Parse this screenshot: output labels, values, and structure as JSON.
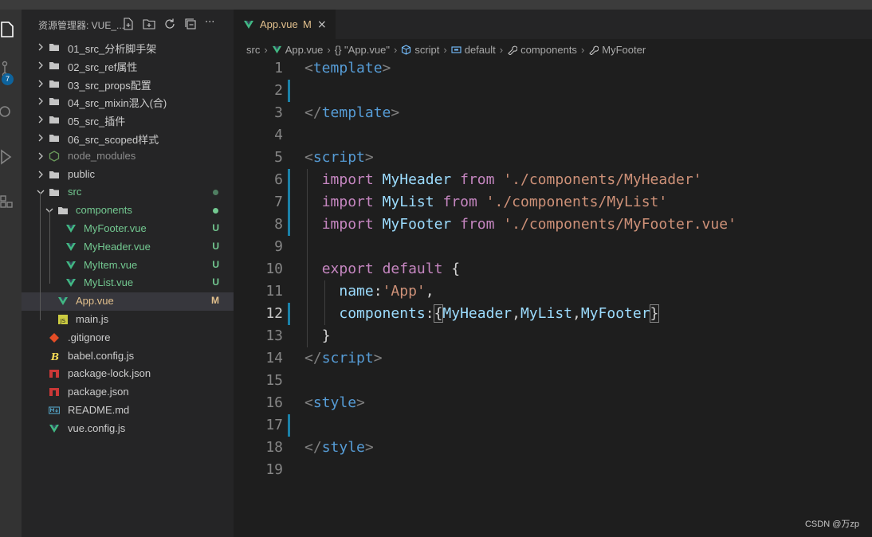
{
  "explorer": {
    "title": "资源管理器: VUE_...",
    "actions": [
      "new-file-icon",
      "new-folder-icon",
      "refresh-icon",
      "collapse-all-icon",
      "more-actions-icon"
    ],
    "more_label": "···",
    "items": [
      {
        "label": "01_src_分析脚手架",
        "type": "folder"
      },
      {
        "label": "02_src_ref属性",
        "type": "folder"
      },
      {
        "label": "03_src_props配置",
        "type": "folder"
      },
      {
        "label": "04_src_mixin混入(合)",
        "type": "folder"
      },
      {
        "label": "05_src_插件",
        "type": "folder"
      },
      {
        "label": "06_src_scoped样式",
        "type": "folder"
      },
      {
        "label": "node_modules",
        "type": "folder"
      },
      {
        "label": "public",
        "type": "folder"
      },
      {
        "label": "src",
        "type": "folder"
      },
      {
        "label": "components",
        "type": "folder"
      },
      {
        "label": "MyFooter.vue",
        "type": "vue",
        "status": "U"
      },
      {
        "label": "MyHeader.vue",
        "type": "vue",
        "status": "U"
      },
      {
        "label": "MyItem.vue",
        "type": "vue",
        "status": "U"
      },
      {
        "label": "MyList.vue",
        "type": "vue",
        "status": "U"
      },
      {
        "label": "App.vue",
        "type": "vue",
        "status": "M"
      },
      {
        "label": "main.js",
        "type": "js"
      },
      {
        "label": ".gitignore",
        "type": "git"
      },
      {
        "label": "babel.config.js",
        "type": "babel"
      },
      {
        "label": "package-lock.json",
        "type": "npm"
      },
      {
        "label": "package.json",
        "type": "npm"
      },
      {
        "label": "README.md",
        "type": "md"
      },
      {
        "label": "vue.config.js",
        "type": "vue"
      }
    ]
  },
  "activity_bar": {
    "source_control_badge": "7"
  },
  "editor": {
    "tab": {
      "label": "App.vue",
      "status": "M",
      "close": "×"
    },
    "breadcrumbs": [
      "src",
      "App.vue",
      "{} \"App.vue\"",
      "script",
      "default",
      "components",
      "MyFooter"
    ],
    "active_line": 12,
    "lines": [
      {
        "n": "1"
      },
      {
        "n": "2"
      },
      {
        "n": "3"
      },
      {
        "n": "4"
      },
      {
        "n": "5"
      },
      {
        "n": "6"
      },
      {
        "n": "7"
      },
      {
        "n": "8"
      },
      {
        "n": "9"
      },
      {
        "n": "10"
      },
      {
        "n": "11"
      },
      {
        "n": "12"
      },
      {
        "n": "13"
      },
      {
        "n": "14"
      },
      {
        "n": "15"
      },
      {
        "n": "16"
      },
      {
        "n": "17"
      },
      {
        "n": "18"
      },
      {
        "n": "19"
      }
    ],
    "code": {
      "l1": [
        "<",
        "template",
        ">"
      ],
      "l3": [
        "</",
        "template",
        ">"
      ],
      "l5": [
        "<",
        "script",
        ">"
      ],
      "l6": [
        "import",
        "MyHeader",
        "from",
        "'./components/MyHeader'"
      ],
      "l7": [
        "import",
        "MyList",
        "from",
        "'./components/MyList'"
      ],
      "l8": [
        "import",
        "MyFooter",
        "from",
        "'./components/MyFooter.vue'"
      ],
      "l10": [
        "export",
        "default",
        "{"
      ],
      "l11": [
        "name",
        ":",
        "'App'",
        ","
      ],
      "l12": [
        "components",
        ":",
        "{",
        "MyHeader",
        ",",
        "MyList",
        ",",
        "MyFooter",
        "}"
      ],
      "l13": [
        "}"
      ],
      "l14": [
        "</",
        "script",
        ">"
      ],
      "l16": [
        "<",
        "style",
        ">"
      ],
      "l18": [
        "</",
        "style",
        ">"
      ]
    }
  },
  "watermark": "CSDN @万zp",
  "colors": {
    "tag": "#569cd6",
    "keyword": "#c586c0",
    "identifier": "#9cdcfe",
    "string": "#ce9178",
    "untracked": "#73c991",
    "modified": "#e2c08d"
  }
}
